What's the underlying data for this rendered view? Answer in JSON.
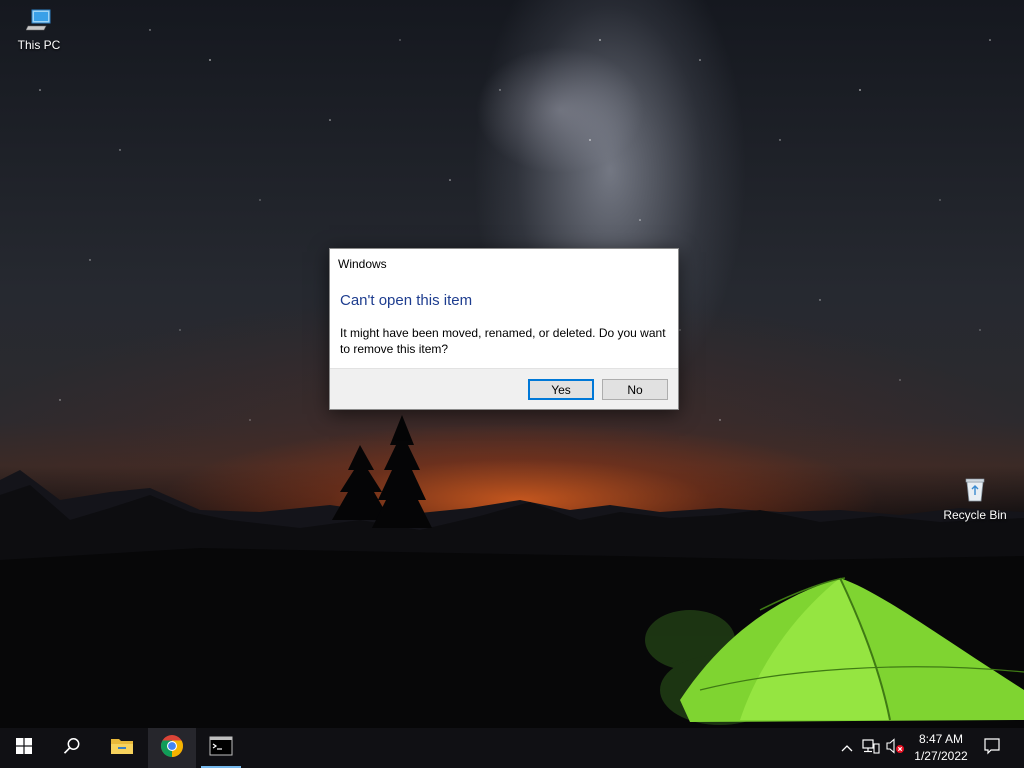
{
  "desktop": {
    "icons": [
      {
        "label": "This PC",
        "icon": "this-pc-icon"
      },
      {
        "label": "Recycle Bin",
        "icon": "recycle-bin-icon"
      }
    ]
  },
  "dialog": {
    "caption": "Windows",
    "heading": "Can't open this item",
    "message": "It might have been moved, renamed, or deleted. Do you want to remove this item?",
    "buttons": {
      "yes": "Yes",
      "no": "No"
    },
    "colors": {
      "heading": "#1e3d8f",
      "default_button_border": "#0078d7"
    }
  },
  "taskbar": {
    "buttons": [
      {
        "name": "start",
        "icon": "windows-logo-icon"
      },
      {
        "name": "search",
        "icon": "search-icon"
      },
      {
        "name": "file-explorer",
        "icon": "folder-icon"
      },
      {
        "name": "chrome",
        "icon": "chrome-icon",
        "active": true
      },
      {
        "name": "command-prompt",
        "icon": "terminal-icon",
        "running": true
      }
    ],
    "tray": {
      "icons": [
        "chevron-up-icon",
        "network-icon",
        "volume-muted-icon"
      ],
      "time": "8:47 AM",
      "date": "1/27/2022",
      "notification_icon": "notification-icon"
    },
    "colors": {
      "background": "#101014",
      "running_indicator": "#76b9ed"
    }
  }
}
